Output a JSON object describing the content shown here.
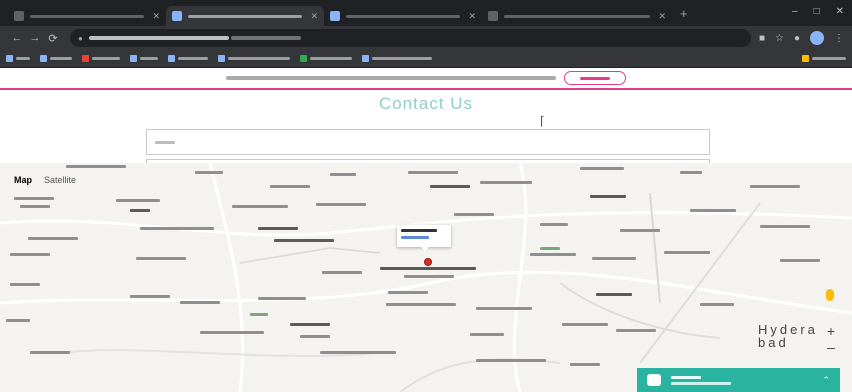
{
  "browser": {
    "tabs": [
      {
        "label": "",
        "active": false
      },
      {
        "label": "",
        "active": true
      },
      {
        "label": "",
        "active": false
      },
      {
        "label": "",
        "active": false
      }
    ],
    "new_tab_glyph": "+",
    "window_controls": [
      "–",
      "□",
      "✕"
    ],
    "toolbar": {
      "back_glyph": "←",
      "forward_glyph": "→",
      "reload_glyph": "⟳",
      "url": ""
    }
  },
  "wix_banner": {
    "message": "",
    "start_button_label": ""
  },
  "page": {
    "title": "Contact Us",
    "name_field_placeholder": ""
  },
  "map": {
    "map_type_map": "Map",
    "map_type_satellite": "Satellite",
    "city_label": "Hyderabad",
    "zoom_in": "+",
    "zoom_out": "–",
    "popup_title": "",
    "popup_link": ""
  },
  "chat_widget": {
    "title": "",
    "subtitle": "",
    "caret": "⌃"
  },
  "colors": {
    "accent_pink": "#e23d8a",
    "title_teal": "#8fcfc9",
    "chat_teal": "#2bb3a2",
    "pin_red": "#d93025"
  }
}
